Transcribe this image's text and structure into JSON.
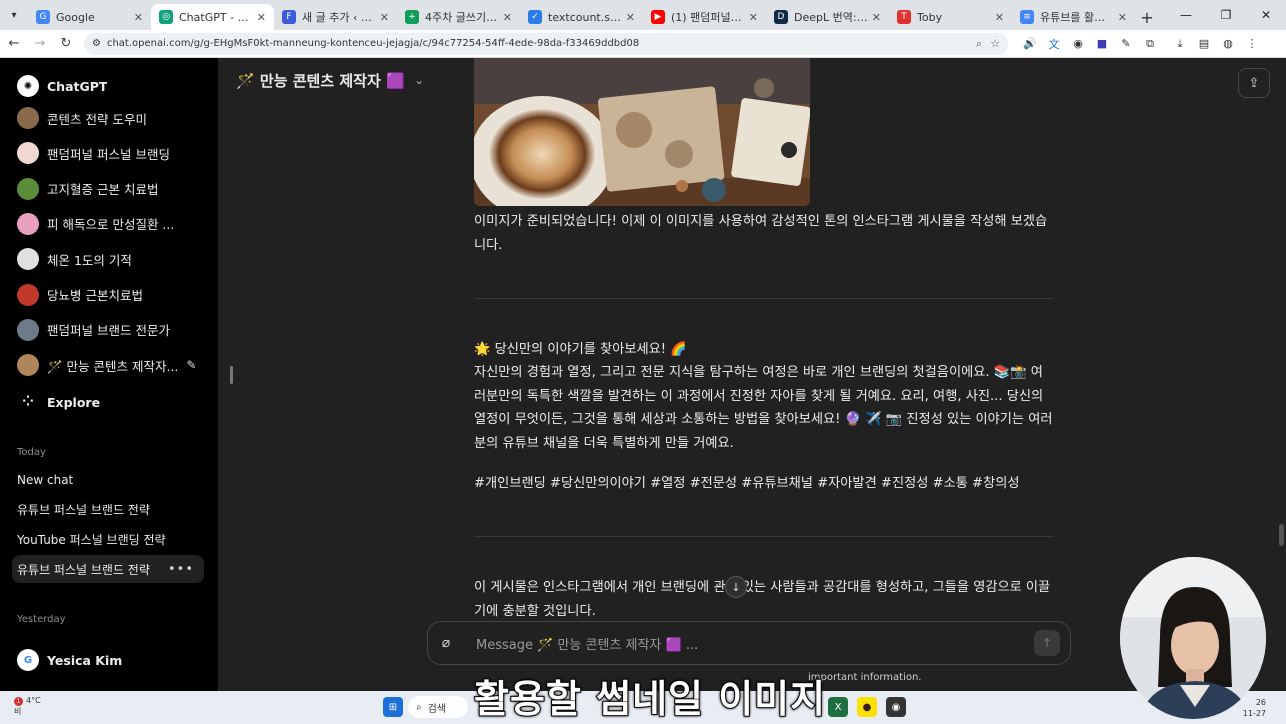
{
  "browser": {
    "tabs": [
      {
        "label": "Google",
        "color": "#4285f4",
        "glyph": "G",
        "active": false
      },
      {
        "label": "ChatGPT - 🪄 만능",
        "color": "#10a37f",
        "glyph": "◎",
        "active": true
      },
      {
        "label": "새 글 추가 ‹ 팬덤퍼널",
        "color": "#3b5bdb",
        "glyph": "F",
        "active": false
      },
      {
        "label": "4주차 글쓰기 프로젝",
        "color": "#0f9d58",
        "glyph": "+",
        "active": false
      },
      {
        "label": "textcount.savoo.com",
        "color": "#2b7de9",
        "glyph": "✓",
        "active": false
      },
      {
        "label": "(1) 팬덤퍼널 - YouTu",
        "color": "#ff0000",
        "glyph": "▶",
        "active": false
      },
      {
        "label": "DeepL 번역: 세계에서",
        "color": "#0f2b46",
        "glyph": "D",
        "active": false
      },
      {
        "label": "Toby",
        "color": "#e03131",
        "glyph": "T",
        "active": false
      },
      {
        "label": "유튜브를 활용한 퍼스",
        "color": "#4285f4",
        "glyph": "≡",
        "active": false
      }
    ],
    "url": "chat.openai.com/g/g-EHgMsF0kt-manneung-kontenceu-jejagja/c/94c77254-54ff-4ede-98da-f33469ddbd08"
  },
  "sidebar": {
    "brand": "ChatGPT",
    "gpts": [
      {
        "label": "콘텐츠 전략 도우미",
        "color": "#8a6a4a"
      },
      {
        "label": "팬덤퍼널 퍼스널 브랜딩",
        "color": "#f1d7d2"
      },
      {
        "label": "고지혈증 근본 치료법",
        "color": "#5c8d3a"
      },
      {
        "label": "피 해독으로 만성질환 ...",
        "color": "#e9a0c0"
      },
      {
        "label": "체온 1도의 기적",
        "color": "#e0e0e0"
      },
      {
        "label": "당뇨병 근본치료법",
        "color": "#c0392b"
      },
      {
        "label": "팬덤퍼널 브랜드 전문가",
        "color": "#6c7a89"
      },
      {
        "label": "🪄 만능 콘텐츠 제작자...",
        "color": "#b0855a"
      }
    ],
    "explore": "Explore",
    "today_label": "Today",
    "today": [
      {
        "label": "New chat"
      },
      {
        "label": "유튜브 퍼스널 브랜드 전략"
      },
      {
        "label": "YouTube 퍼스널 브랜딩 전략"
      },
      {
        "label": "유튜브 퍼스널 브랜드 전략"
      }
    ],
    "yesterday_label": "Yesterday",
    "user": "Yesica Kim"
  },
  "main": {
    "gpt_title": "🪄 만능 콘텐츠 제작자 🟪",
    "msg1": "이미지가 준비되었습니다! 이제 이 이미지를 사용하여 감성적인 톤의 인스타그램 게시물을 작성해 보겠습니다.",
    "post_heading": "🌟 당신만의 이야기를 찾아보세요! 🌈",
    "post_body": "자신만의 경험과 열정, 그리고 전문 지식을 탐구하는 여정은 바로 개인 브랜딩의 첫걸음이에요. 📚📸 여러분만의 독특한 색깔을 발견하는 이 과정에서 진정한 자아를 찾게 될 거예요. 요리, 여행, 사진... 당신의 열정이 무엇이든, 그것을 통해 세상과 소통하는 방법을 찾아보세요! 🔮 ✈️ 📷 진정성 있는 이야기는 여러분의 유튜브 채널을 더욱 특별하게 만들 거예요.",
    "hashtags": "#개인브랜딩 #당신만의이야기 #열정 #전문성 #유튜브채널 #자아발견 #진정성 #소통 #창의성",
    "msg3": "이 게시물은 인스타그램에서 개인 브랜딩에 관심 있는 사람들과 공감대를 형성하고, 그들을 영감으로 이끌기에 충분할 것입니다.",
    "composer_placeholder": "Message 🪄 만능 콘텐츠 제작자 🟪 ...",
    "footnote": "important information."
  },
  "taskbar": {
    "temp": "4°C",
    "weather_sub": "비",
    "badge": "1",
    "search": "검색",
    "time": "26",
    "date": "11-27"
  },
  "overlay": {
    "subtitle": "활용할 썸네일 이미지"
  }
}
